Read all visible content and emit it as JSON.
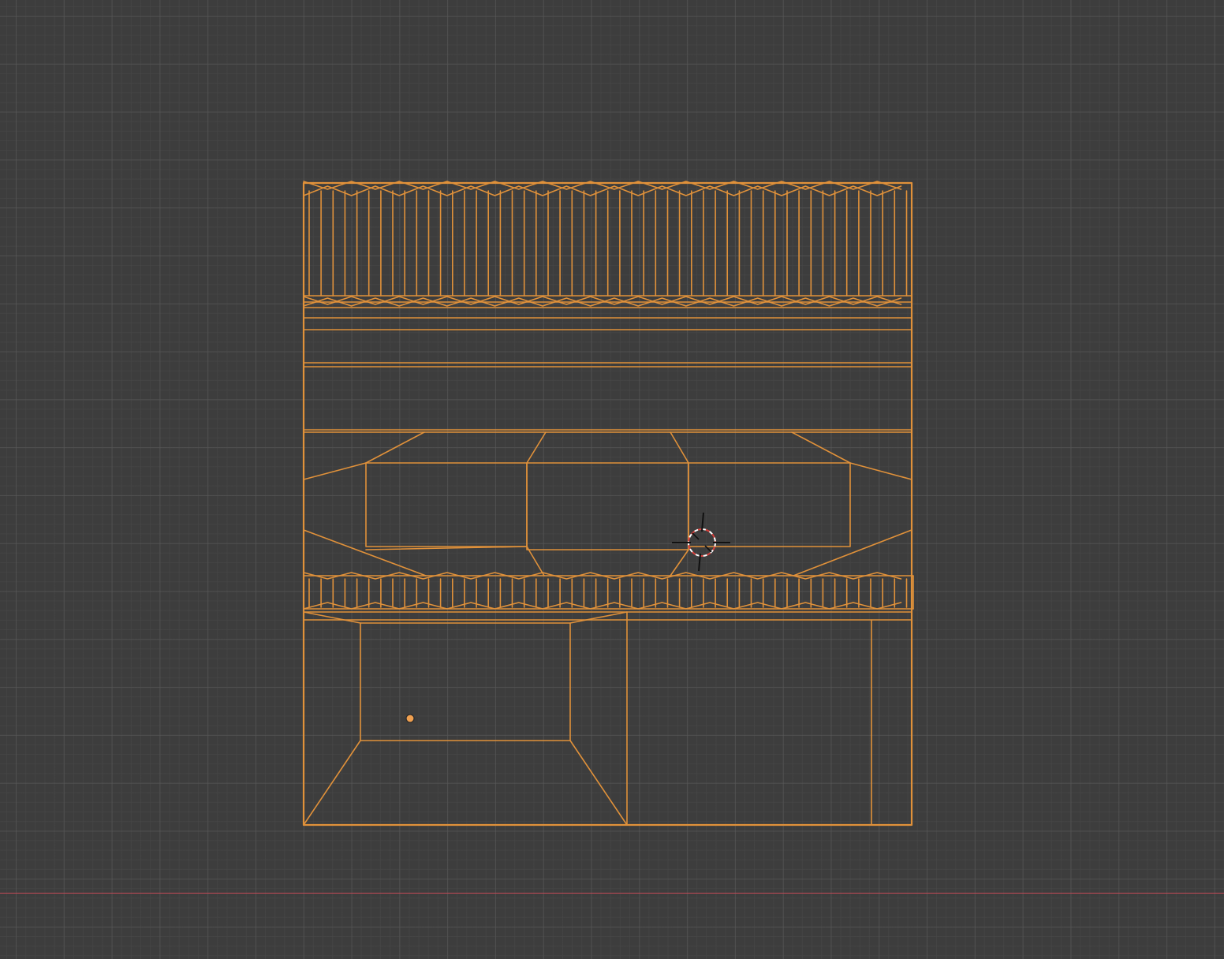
{
  "viewport": {
    "background_color": "#3d3d3d",
    "grid_color": "#4a4a4a",
    "x_axis_color": "#c24a57",
    "mesh_wire_color": "#e0913a",
    "origin_dot_color": "#f0a050"
  },
  "scene": {
    "selected_object": "mesh",
    "display_mode": "wireframe",
    "cursor_icon": "3d-cursor-icon",
    "origin_icon": "object-origin-icon"
  }
}
